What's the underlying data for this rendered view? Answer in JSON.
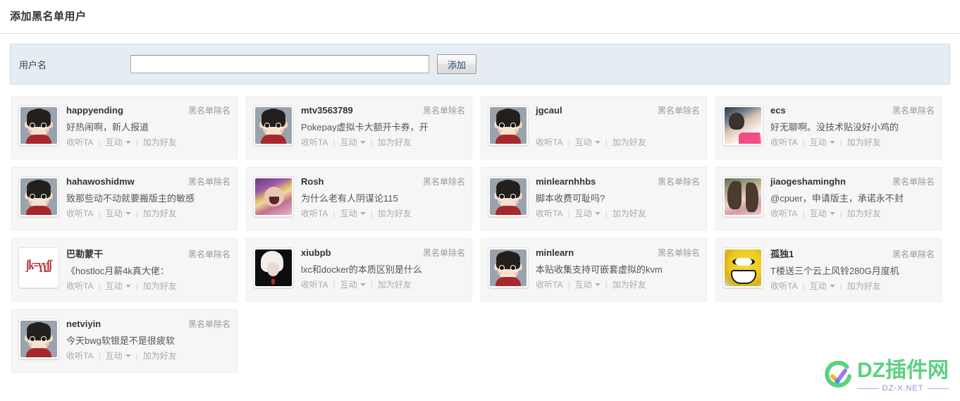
{
  "page": {
    "title": "添加黑名单用户"
  },
  "form": {
    "label": "用户名",
    "input_value": "",
    "input_placeholder": "",
    "submit_label": "添加"
  },
  "card_common": {
    "remove_label": "黑名单除名",
    "action_follow": "收听TA",
    "action_interact": "互动",
    "action_add_friend": "加为好友",
    "separator": "|"
  },
  "users": [
    {
      "username": "happyending",
      "signature": "好热闹啊，新人报道",
      "avatar": "default-cartoon-avatar"
    },
    {
      "username": "mtv3563789",
      "signature": "Pokepay虚拟卡大额开卡券，开",
      "avatar": "default-cartoon-avatar"
    },
    {
      "username": "jgcaul",
      "signature": "",
      "avatar": "default-cartoon-avatar"
    },
    {
      "username": "ecs",
      "signature": "好无聊啊。没技术贴没好小鸡的",
      "avatar": "photo-avatar-ecs"
    },
    {
      "username": "hahawoshidmw",
      "signature": "致那些动不动就要搬版主的敏感",
      "avatar": "default-cartoon-avatar"
    },
    {
      "username": "Rosh",
      "signature": "为什么老有人阴谋论115",
      "avatar": "photo-avatar-rosh"
    },
    {
      "username": "minlearnhhbs",
      "signature": "脚本收费可耻吗?",
      "avatar": "default-cartoon-avatar"
    },
    {
      "username": "jiaogeshaminghn",
      "signature": "@cpuer，申请版主，承诺永不封",
      "avatar": "photo-avatar-jiaoge"
    },
    {
      "username": "巴勒蒙干",
      "signature": "《hostloc月薪4k真大佬：",
      "avatar": "red-glyph-avatar",
      "avatar_glyphs": "ʃk=ɣɣʃʃ"
    },
    {
      "username": "xiubpb",
      "signature": "lxc和docker的本质区别是什么",
      "avatar": "photo-avatar-xiubpb"
    },
    {
      "username": "minlearn",
      "signature": "本贴收集支持可嵌套虚拟的kvm",
      "avatar": "default-cartoon-avatar"
    },
    {
      "username": "孤独1",
      "signature": "T楼送三个云上风铃280G月度机",
      "avatar": "emoji-avatar-gudu"
    },
    {
      "username": "netviyin",
      "signature": "今天bwg软银是不是很疲软",
      "avatar": "default-cartoon-avatar"
    }
  ],
  "watermark": {
    "title": "DZ插件网",
    "subtitle": "DZ-X.NET",
    "green": "#5ad17f",
    "purple": "#9b87e0",
    "orange": "#f5ad3c",
    "blue": "#3d8ef0"
  }
}
